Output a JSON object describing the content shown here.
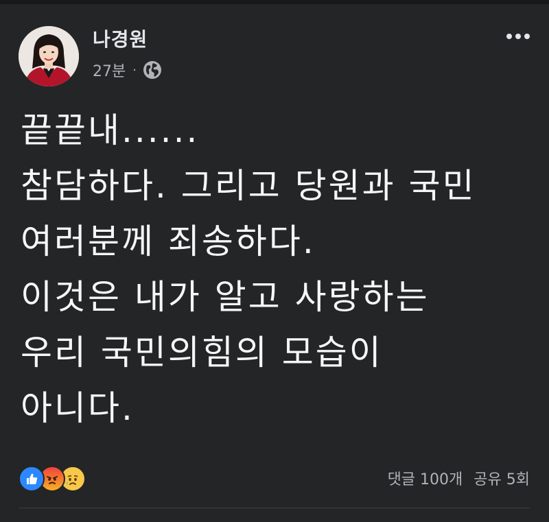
{
  "post": {
    "author": "나경원",
    "time": "27분",
    "meta_separator": "·",
    "privacy_icon": "globe-icon",
    "more_icon": "more-horizontal-icon",
    "lines": [
      "끝끝내......",
      "참담하다. 그리고 당원과 국민",
      "여러분께 죄송하다.",
      "이것은 내가 알고 사랑하는",
      "우리 국민의힘의 모습이",
      "아니다."
    ]
  },
  "reactions": [
    {
      "icon": "like-reaction-icon",
      "color": "#2d88ff"
    },
    {
      "icon": "angry-reaction-icon",
      "color": "#f0433b"
    },
    {
      "icon": "sad-reaction-icon",
      "color": "#f7c94b"
    }
  ],
  "stats": {
    "comments": "댓글 100개",
    "shares": "공유 5회"
  },
  "colors": {
    "background": "#242526",
    "text": "#e4e6eb",
    "secondary_text": "#b0b3b8"
  }
}
